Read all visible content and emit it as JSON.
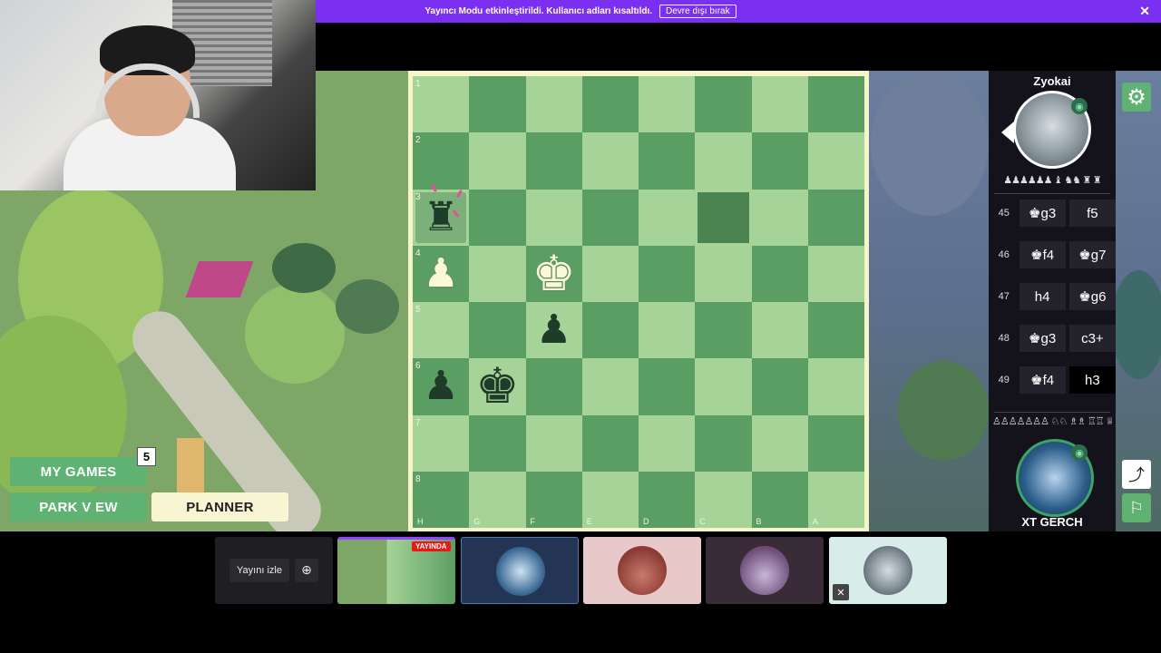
{
  "banner": {
    "message": "Yayıncı Modu etkinleştirildi. Kullanıcı adları kısaltıldı.",
    "button_label": "Devre dışı bırak",
    "close_icon": "✕"
  },
  "left_menu": {
    "my_games_label": "MY GAMES",
    "my_games_count": "5",
    "park_view_label": "PARK V EW",
    "planner_label": "PLANNER"
  },
  "board": {
    "ranks": [
      "1",
      "2",
      "3",
      "4",
      "5",
      "6",
      "7",
      "8"
    ],
    "files": [
      "H",
      "G",
      "F",
      "E",
      "D",
      "C",
      "B",
      "A"
    ],
    "colors": {
      "light": "#a6d397",
      "dark": "#5b9e63",
      "frame": "#f6f4c8"
    },
    "pieces": [
      {
        "square": "H3",
        "piece": "rook",
        "color": "black",
        "glyph": "♜"
      },
      {
        "square": "H4",
        "piece": "pawn",
        "color": "white",
        "glyph": "♟"
      },
      {
        "square": "F4",
        "piece": "king",
        "color": "white",
        "glyph": "♚"
      },
      {
        "square": "F5",
        "piece": "pawn",
        "color": "black",
        "glyph": "♟"
      },
      {
        "square": "H6",
        "piece": "pawn",
        "color": "black",
        "glyph": "♟"
      },
      {
        "square": "G6",
        "piece": "king",
        "color": "black",
        "glyph": "♚"
      }
    ],
    "highlight_squares": [
      "C3"
    ],
    "selected_square": "H3"
  },
  "players": {
    "top": {
      "name": "Zyokai",
      "captured": "♟♟♟♟♟♟ ♝ ♞♞ ♜ ♜"
    },
    "bottom": {
      "name": "XT GERCH",
      "captured": "♙♙♙♙♙♙♙ ♘♘ ♗♗ ♖♖ ♕"
    }
  },
  "moves": [
    {
      "num": "45",
      "white": "♚g3",
      "black": "f5"
    },
    {
      "num": "46",
      "white": "♚f4",
      "black": "♚g7"
    },
    {
      "num": "47",
      "white": "h4",
      "black": "♚g6"
    },
    {
      "num": "48",
      "white": "♚g3",
      "black": "c3+"
    },
    {
      "num": "49",
      "white": "♚f4",
      "black": "h3"
    }
  ],
  "bottom_bar": {
    "watch_label": "Yayını izle",
    "live_label": "YAYINDA",
    "zoom_icon": "⊕"
  },
  "icons": {
    "gear": "⚙",
    "share": "⤴",
    "flag": "⚐",
    "eye": "◉"
  }
}
